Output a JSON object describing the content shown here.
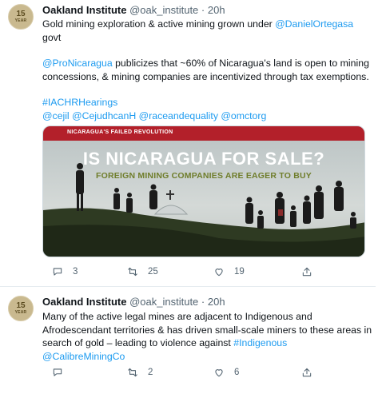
{
  "tweets": [
    {
      "avatar": {
        "big": "15",
        "small": "YEAR"
      },
      "author": "Oakland Institute",
      "handle": "@oak_institute",
      "sep": "·",
      "time": "20h",
      "line1_pre": "Gold mining exploration & active mining grown under ",
      "line1_link": "@DanielOrtegasa",
      "line1_post": "govt",
      "para2_link": "@ProNicaragua",
      "para2_text": " publicizes that ~60% of Nicaragua's land is open to mining concessions, & mining companies are incentivized through tax exemptions.",
      "hashtag": "#IACHRHearings",
      "mentions": "@cejil @CejudhcanH @raceandequality @omctorg",
      "media": {
        "banner": "NICARAGUA'S FAILED REVOLUTION",
        "headline": "IS NICARAGUA FOR SALE?",
        "subheadline": "FOREIGN MINING COMPANIES ARE EAGER TO BUY"
      },
      "actions": {
        "reply_count": "3",
        "retweet_count": "25",
        "like_count": "19"
      }
    },
    {
      "avatar": {
        "big": "15",
        "small": "YEAR"
      },
      "author": "Oakland Institute",
      "handle": "@oak_institute",
      "sep": "·",
      "time": "20h",
      "text": "Many of the active legal mines are adjacent to Indigenous and Afrodescendant territories & has driven small-scale miners to these areas in search of gold – leading to violence against ",
      "hashtag": "#Indigenous",
      "mention": "@CalibreMiningCo",
      "actions": {
        "reply_count": "",
        "retweet_count": "2",
        "like_count": "6"
      }
    }
  ],
  "colors": {
    "link": "#1d9bf0",
    "banner": "#b3202a",
    "muted": "#536471"
  }
}
